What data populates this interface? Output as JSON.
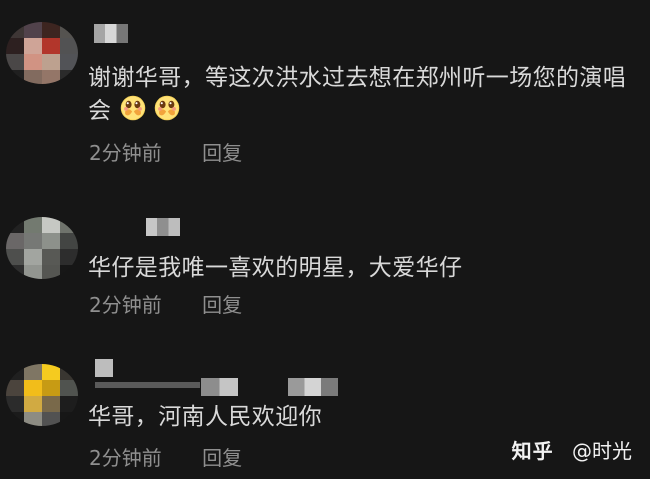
{
  "comments": [
    {
      "text": "谢谢华哥，等这次洪水过去想在郑州听一场您的演唱会",
      "emoji_icons": [
        "covering-mouth-face-icon",
        "covering-mouth-face-icon"
      ],
      "time": "2分钟前",
      "reply": "回复"
    },
    {
      "text": "华仔是我唯一喜欢的明星，大爱华仔",
      "time": "2分钟前",
      "reply": "回复"
    },
    {
      "text": "华哥，河南人民欢迎你",
      "time": "2分钟前",
      "reply": "回复"
    }
  ],
  "watermark": {
    "platform": "知乎",
    "author": "@时光"
  },
  "colors": {
    "background": "#161616",
    "text": "#d9d9d9",
    "meta": "#8f8f8f",
    "watermark": "#f2f2f2"
  }
}
